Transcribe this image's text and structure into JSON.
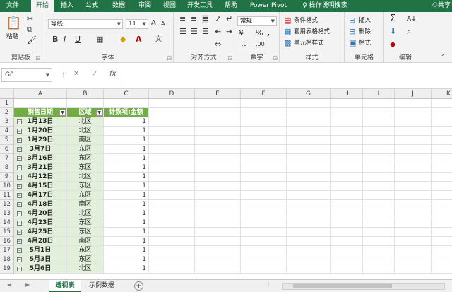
{
  "ribbon_tabs": [
    "文件",
    "开始",
    "插入",
    "公式",
    "数据",
    "审阅",
    "视图",
    "开发工具",
    "帮助",
    "Power Pivot",
    "操作说明搜索"
  ],
  "active_tab": "开始",
  "share_label": "共享",
  "clipboard": {
    "paste": "粘贴",
    "label": "剪贴板"
  },
  "font": {
    "name": "等线",
    "size": "11",
    "label": "字体",
    "bold": "B",
    "italic": "I",
    "underline": "U",
    "grow": "A",
    "shrink": "A",
    "color_glyph": "A",
    "wen": "文"
  },
  "align": {
    "label": "对齐方式"
  },
  "number": {
    "format": "常规",
    "label": "数字",
    "percent": "%",
    "comma": ","
  },
  "styles": {
    "cond": "条件格式",
    "table": "套用表格格式",
    "cell": "单元格样式",
    "label": "样式"
  },
  "cells": {
    "insert": "插入",
    "delete": "删除",
    "format": "格式",
    "label": "单元格"
  },
  "editing": {
    "label": "编辑",
    "sum": "Σ",
    "sort": "A↓",
    "find": "⌕"
  },
  "formula_bar": {
    "name_box": "G8",
    "cancel": "✕",
    "confirm": "✓",
    "fx": "fx",
    "formula": ""
  },
  "columns": [
    "A",
    "B",
    "C",
    "D",
    "E",
    "F",
    "G",
    "H",
    "I",
    "J",
    "K"
  ],
  "rows": [
    "1",
    "2",
    "3",
    "4",
    "5",
    "6",
    "7",
    "8",
    "9",
    "10",
    "11",
    "12",
    "13",
    "14",
    "15",
    "16",
    "17",
    "18",
    "19"
  ],
  "pivot": {
    "headers": [
      "销售日期",
      "区域",
      "计数项:金额"
    ],
    "records": [
      {
        "date": "1月13日",
        "region": "北区",
        "count": "1"
      },
      {
        "date": "1月20日",
        "region": "北区",
        "count": "1"
      },
      {
        "date": "1月29日",
        "region": "南区",
        "count": "1"
      },
      {
        "date": "3月7日",
        "region": "东区",
        "count": "1"
      },
      {
        "date": "3月16日",
        "region": "东区",
        "count": "1"
      },
      {
        "date": "3月21日",
        "region": "东区",
        "count": "1"
      },
      {
        "date": "4月12日",
        "region": "北区",
        "count": "1"
      },
      {
        "date": "4月15日",
        "region": "东区",
        "count": "1"
      },
      {
        "date": "4月17日",
        "region": "东区",
        "count": "1"
      },
      {
        "date": "4月18日",
        "region": "南区",
        "count": "1"
      },
      {
        "date": "4月20日",
        "region": "北区",
        "count": "1"
      },
      {
        "date": "4月23日",
        "region": "东区",
        "count": "1"
      },
      {
        "date": "4月25日",
        "region": "东区",
        "count": "1"
      },
      {
        "date": "4月28日",
        "region": "南区",
        "count": "1"
      },
      {
        "date": "5月1日",
        "region": "东区",
        "count": "1"
      },
      {
        "date": "5月3日",
        "region": "东区",
        "count": "1"
      },
      {
        "date": "5月6日",
        "region": "北区",
        "count": "1"
      }
    ]
  },
  "sheets": [
    "透视表",
    "示例数据"
  ],
  "active_sheet": "透视表",
  "colors": {
    "brand": "#217346",
    "header_fill": "#70ad47",
    "band_fill": "#e2efda"
  }
}
